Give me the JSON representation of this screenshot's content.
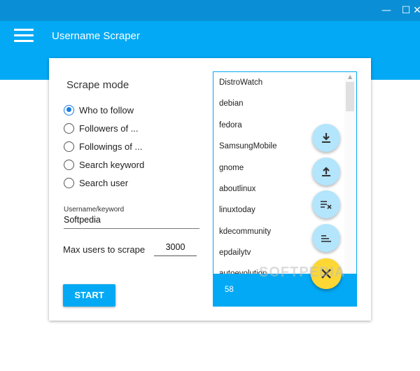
{
  "window": {
    "minimize_glyph": "—",
    "maximize_glyph": "☐",
    "close_glyph": "✕"
  },
  "header": {
    "title": "Username Scraper",
    "menu_icon": "hamburger-menu-icon"
  },
  "colors": {
    "titlebar": "#0a8fd6",
    "accent": "#03a9f4",
    "fab_light": "#b3e5fc",
    "fab_primary": "#fdd835"
  },
  "scrape_mode": {
    "title": "Scrape mode",
    "options": [
      {
        "label": "Who to follow",
        "selected": true
      },
      {
        "label": "Followers of ...",
        "selected": false
      },
      {
        "label": "Followings of ...",
        "selected": false
      },
      {
        "label": "Search keyword",
        "selected": false
      },
      {
        "label": "Search user",
        "selected": false
      }
    ]
  },
  "username_field": {
    "caption": "Username/keyword",
    "value": "Softpedia"
  },
  "max_users": {
    "label": "Max users to scrape",
    "value": "3000"
  },
  "start_button": {
    "label": "START"
  },
  "user_list": {
    "items": [
      "DistroWatch",
      "debian",
      "fedora",
      "SamsungMobile",
      "gnome",
      "aboutlinux",
      "linuxtoday",
      "kdecommunity",
      "epdailytv",
      "autoevolution"
    ],
    "count": "58"
  },
  "fabs": [
    {
      "icon": "download-icon"
    },
    {
      "icon": "upload-icon"
    },
    {
      "icon": "clear-list-icon"
    },
    {
      "icon": "sort-list-icon"
    },
    {
      "icon": "close-icon"
    }
  ],
  "watermark": "SOFTPEDIA"
}
